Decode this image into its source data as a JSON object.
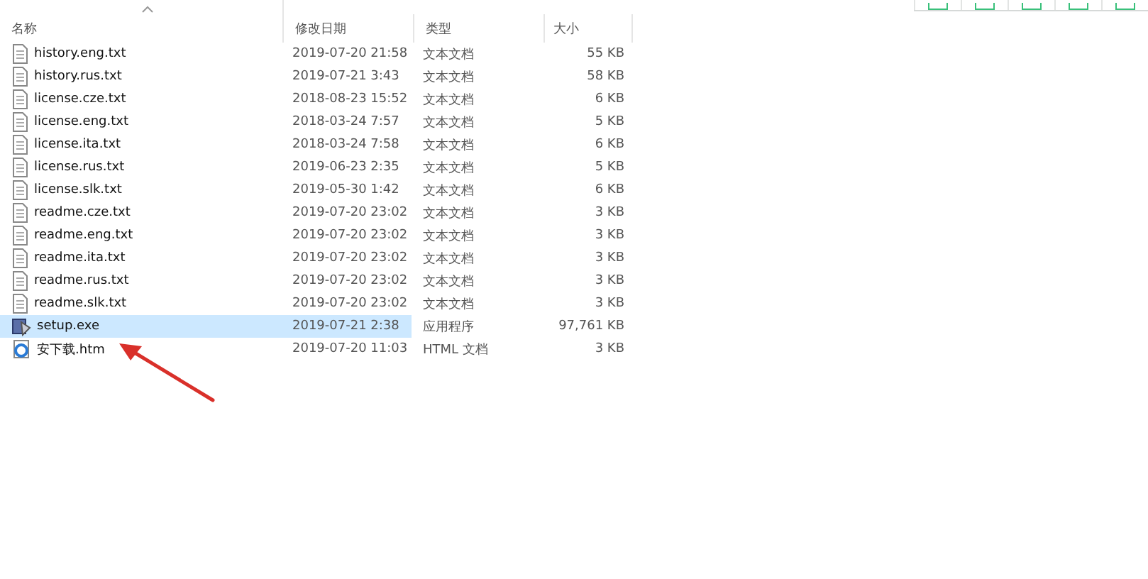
{
  "columns": [
    {
      "label": "名称",
      "sorted": true
    },
    {
      "label": "修改日期",
      "sorted": false
    },
    {
      "label": "类型",
      "sorted": false
    },
    {
      "label": "大小",
      "sorted": false
    }
  ],
  "files": [
    {
      "name": "history.eng.txt",
      "kind": "text",
      "date": "2019-07-20 21:58",
      "type": "文本文档",
      "size": "55 KB",
      "selected": false
    },
    {
      "name": "history.rus.txt",
      "kind": "text",
      "date": "2019-07-21 3:43",
      "type": "文本文档",
      "size": "58 KB",
      "selected": false
    },
    {
      "name": "license.cze.txt",
      "kind": "text",
      "date": "2018-08-23 15:52",
      "type": "文本文档",
      "size": "6 KB",
      "selected": false
    },
    {
      "name": "license.eng.txt",
      "kind": "text",
      "date": "2018-03-24 7:57",
      "type": "文本文档",
      "size": "5 KB",
      "selected": false
    },
    {
      "name": "license.ita.txt",
      "kind": "text",
      "date": "2018-03-24 7:58",
      "type": "文本文档",
      "size": "6 KB",
      "selected": false
    },
    {
      "name": "license.rus.txt",
      "kind": "text",
      "date": "2019-06-23 2:35",
      "type": "文本文档",
      "size": "5 KB",
      "selected": false
    },
    {
      "name": "license.slk.txt",
      "kind": "text",
      "date": "2019-05-30 1:42",
      "type": "文本文档",
      "size": "6 KB",
      "selected": false
    },
    {
      "name": "readme.cze.txt",
      "kind": "text",
      "date": "2019-07-20 23:02",
      "type": "文本文档",
      "size": "3 KB",
      "selected": false
    },
    {
      "name": "readme.eng.txt",
      "kind": "text",
      "date": "2019-07-20 23:02",
      "type": "文本文档",
      "size": "3 KB",
      "selected": false
    },
    {
      "name": "readme.ita.txt",
      "kind": "text",
      "date": "2019-07-20 23:02",
      "type": "文本文档",
      "size": "3 KB",
      "selected": false
    },
    {
      "name": "readme.rus.txt",
      "kind": "text",
      "date": "2019-07-20 23:02",
      "type": "文本文档",
      "size": "3 KB",
      "selected": false
    },
    {
      "name": "readme.slk.txt",
      "kind": "text",
      "date": "2019-07-20 23:02",
      "type": "文本文档",
      "size": "3 KB",
      "selected": false
    },
    {
      "name": "setup.exe",
      "kind": "exe",
      "date": "2019-07-21 2:38",
      "type": "应用程序",
      "size": "97,761 KB",
      "selected": true
    },
    {
      "name": "安下载.htm",
      "kind": "web",
      "date": "2019-07-20 11:03",
      "type": "HTML 文档",
      "size": "3 KB",
      "selected": false
    }
  ]
}
